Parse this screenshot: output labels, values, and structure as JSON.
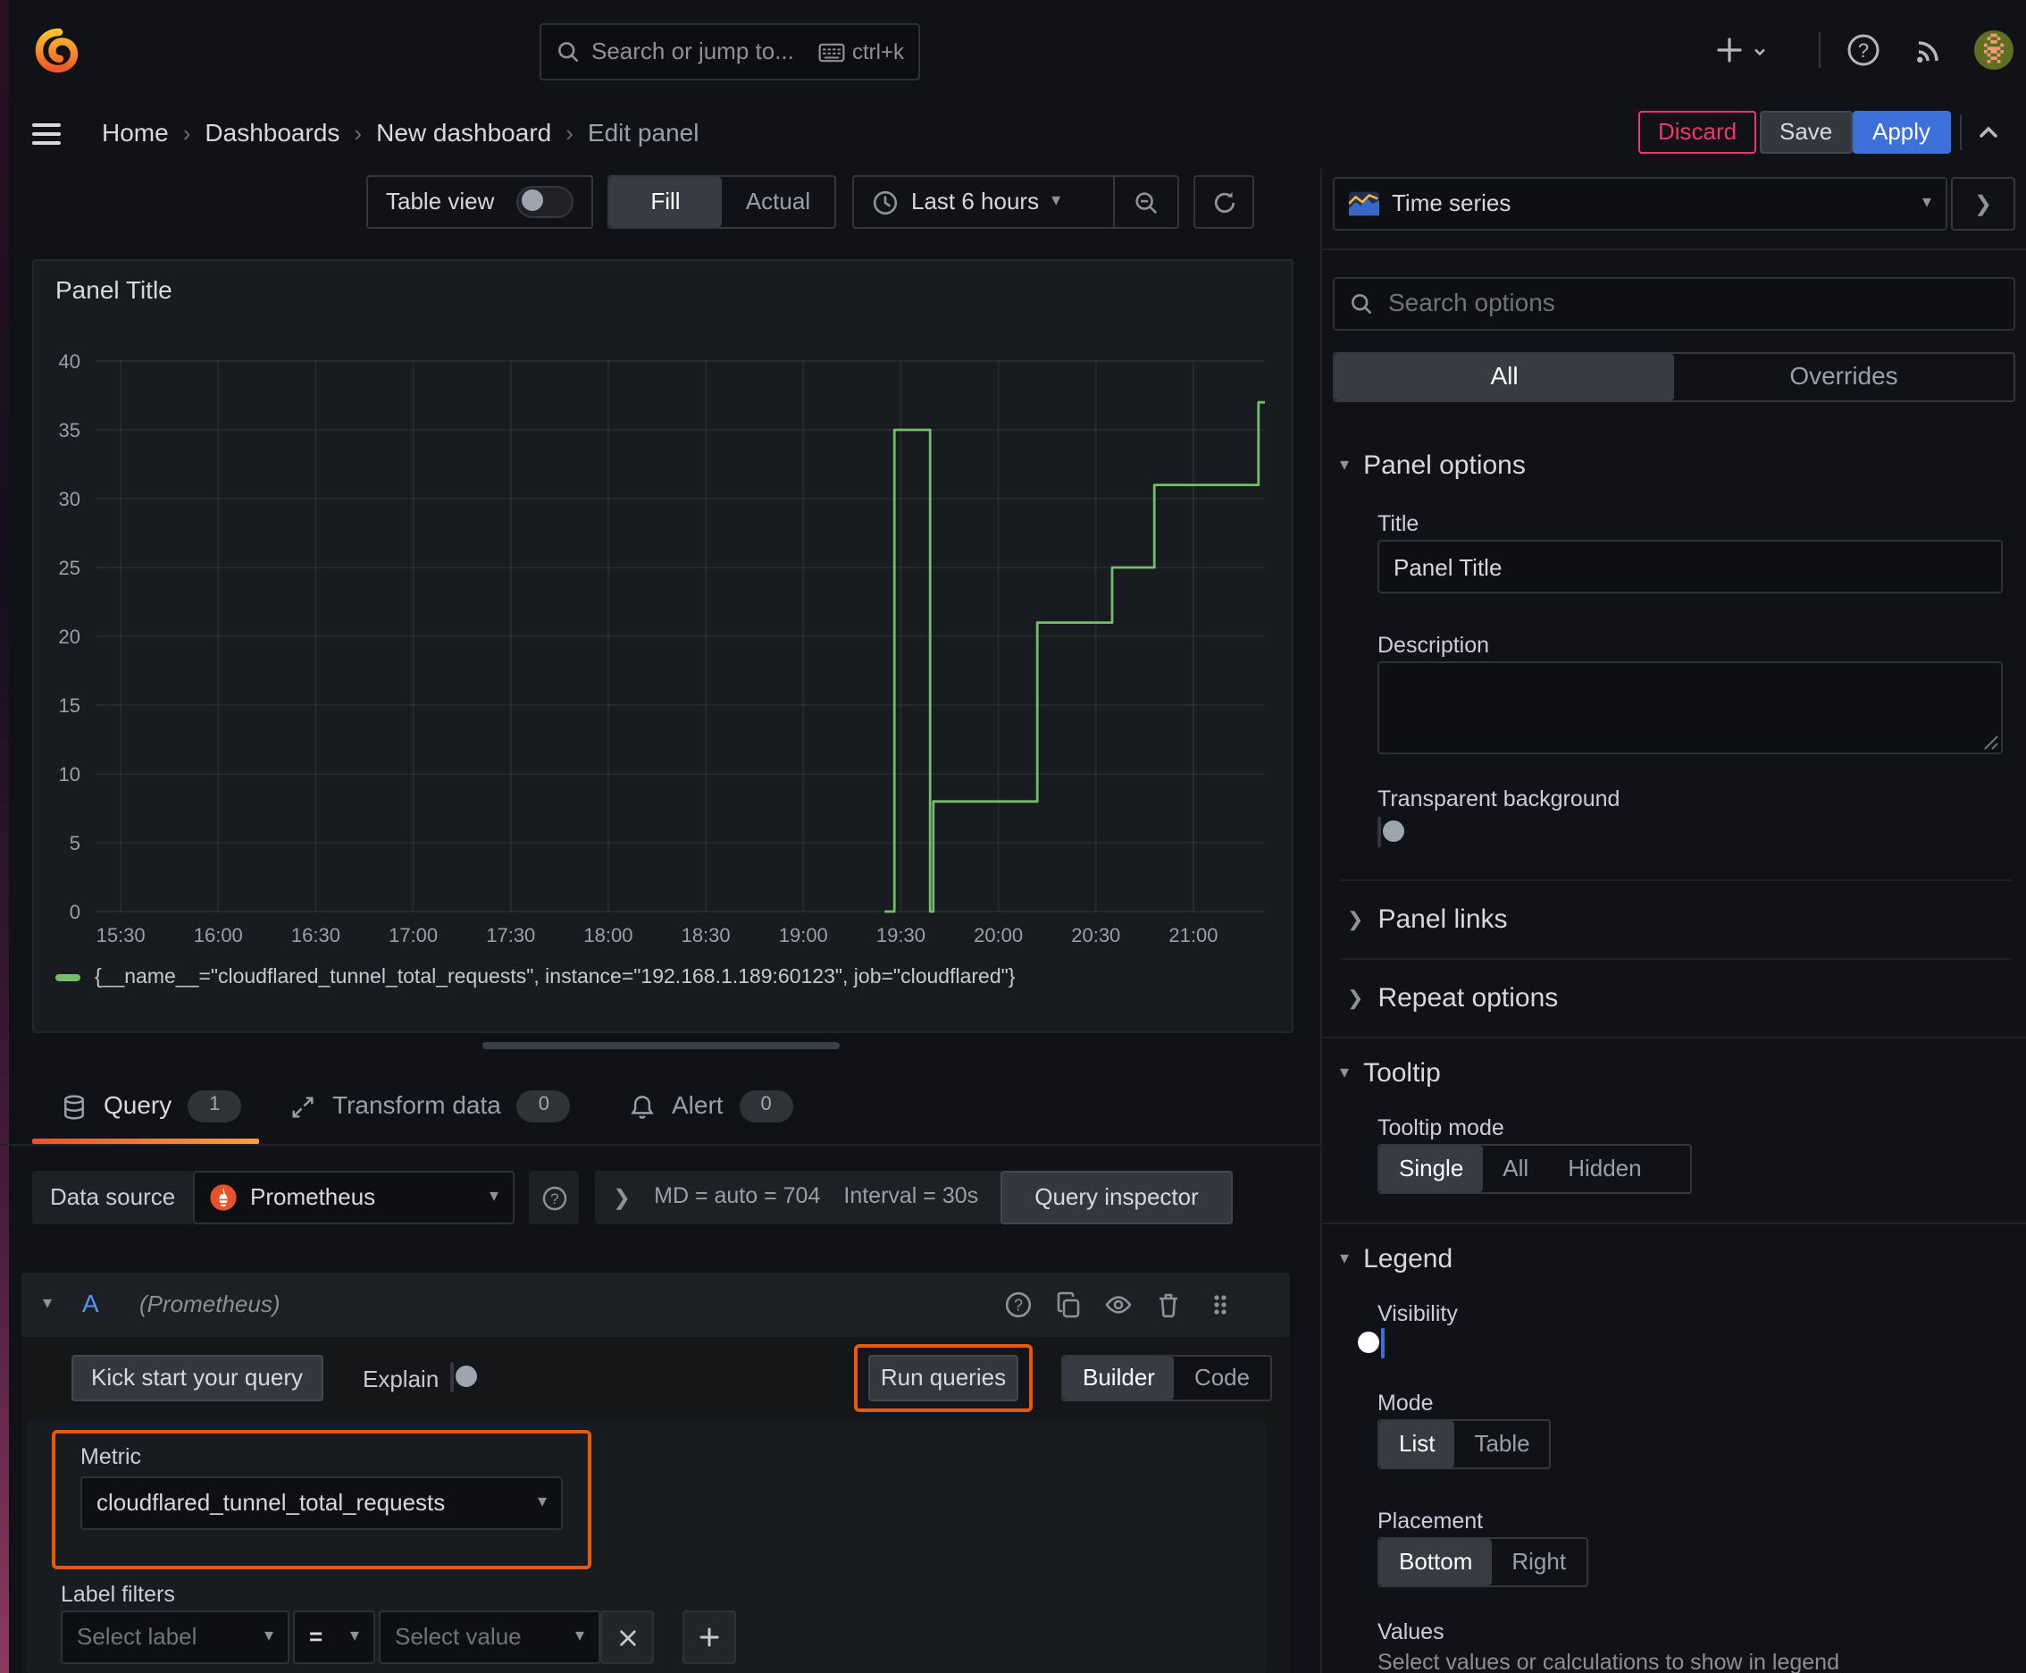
{
  "colors": {
    "background": "#111217",
    "panel_bg": "#181b1f",
    "accent_orange": "#ff780a",
    "annotation_highlight": "#e8590c",
    "primary_blue": "#3d71d9",
    "danger_pink": "#f1366e",
    "series_green": "#73bf69"
  },
  "topbar": {
    "search_placeholder": "Search or jump to...",
    "shortcut": "ctrl+k"
  },
  "breadcrumb": {
    "items": [
      "Home",
      "Dashboards",
      "New dashboard",
      "Edit panel"
    ],
    "separator": "›",
    "discard": "Discard",
    "save": "Save",
    "apply": "Apply"
  },
  "toolbar": {
    "table_view": "Table view",
    "fill": "Fill",
    "actual": "Actual",
    "time_range": "Last 6 hours"
  },
  "panel": {
    "title": "Panel Title"
  },
  "chart_data": {
    "type": "line",
    "title": "Panel Title",
    "x_ticks": [
      "15:30",
      "16:00",
      "16:30",
      "17:00",
      "17:30",
      "18:00",
      "18:30",
      "19:00",
      "19:30",
      "20:00",
      "20:30",
      "21:00"
    ],
    "y_ticks": [
      0,
      5,
      10,
      15,
      20,
      25,
      30,
      35,
      40
    ],
    "ylim": [
      0,
      40
    ],
    "x_axis_minutes_range": [
      -8,
      352
    ],
    "grid": true,
    "legend_position": "bottom",
    "line_color": "#73bf69",
    "series": [
      {
        "name": "{__name__=\"cloudflared_tunnel_total_requests\", instance=\"192.168.1.189:60123\", job=\"cloudflared\"}",
        "step": "after",
        "points_t_min_from_1530": [
          [
            235,
            0
          ],
          [
            238,
            35
          ],
          [
            249,
            0
          ],
          [
            250,
            8
          ],
          [
            282,
            21
          ],
          [
            305,
            25
          ],
          [
            318,
            31
          ],
          [
            350,
            37
          ],
          [
            352,
            37
          ]
        ]
      }
    ]
  },
  "tabs": {
    "query": "Query",
    "query_count": "1",
    "transform": "Transform data",
    "transform_count": "0",
    "alert": "Alert",
    "alert_count": "0"
  },
  "datasource": {
    "label": "Data source",
    "name": "Prometheus",
    "stats_md": "MD = auto = 704",
    "stats_interval": "Interval = 30s",
    "inspector": "Query inspector"
  },
  "query_row": {
    "ref_id": "A",
    "datasource_hint": "(Prometheus)",
    "kick_start": "Kick start your query",
    "explain": "Explain",
    "run_queries": "Run queries",
    "builder": "Builder",
    "code": "Code",
    "metric_label": "Metric",
    "metric_value": "cloudflared_tunnel_total_requests",
    "label_filters_label": "Label filters",
    "select_label": "Select label",
    "operator": "=",
    "select_value": "Select value"
  },
  "sidebar": {
    "viz_name": "Time series",
    "search_placeholder": "Search options",
    "tab_all": "All",
    "tab_overrides": "Overrides",
    "panel_options": {
      "title": "Panel options",
      "title_label": "Title",
      "title_value": "Panel Title",
      "description_label": "Description",
      "transparent_label": "Transparent background"
    },
    "panel_links": "Panel links",
    "repeat_options": "Repeat options",
    "tooltip": {
      "title": "Tooltip",
      "mode_label": "Tooltip mode",
      "options": [
        "Single",
        "All",
        "Hidden"
      ]
    },
    "legend": {
      "title": "Legend",
      "visibility_label": "Visibility",
      "mode_label": "Mode",
      "mode_options": [
        "List",
        "Table"
      ],
      "placement_label": "Placement",
      "placement_options": [
        "Bottom",
        "Right"
      ],
      "values_label": "Values",
      "values_help": "Select values or calculations to show in legend"
    }
  }
}
